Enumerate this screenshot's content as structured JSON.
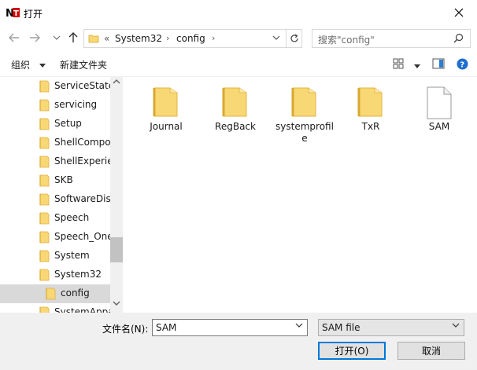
{
  "window": {
    "title": "打开"
  },
  "address": {
    "overflow": "«",
    "crumbs": [
      "System32",
      "config"
    ]
  },
  "search": {
    "placeholder": "搜索\"config\""
  },
  "toolbar": {
    "organize_label": "组织",
    "new_folder_label": "新建文件夹"
  },
  "sidebar": {
    "items": [
      {
        "label": "ServiceState"
      },
      {
        "label": "servicing"
      },
      {
        "label": "Setup"
      },
      {
        "label": "ShellCompo"
      },
      {
        "label": "ShellExperie"
      },
      {
        "label": "SKB"
      },
      {
        "label": "SoftwareDist"
      },
      {
        "label": "Speech"
      },
      {
        "label": "Speech_One"
      },
      {
        "label": "System"
      },
      {
        "label": "System32"
      },
      {
        "label": "config"
      },
      {
        "label": "SystemAppa"
      }
    ],
    "selected_index": 11
  },
  "files": [
    {
      "name": "Journal",
      "type": "folder"
    },
    {
      "name": "RegBack",
      "type": "folder"
    },
    {
      "name": "systemprofile",
      "type": "folder"
    },
    {
      "name": "TxR",
      "type": "folder"
    },
    {
      "name": "SAM",
      "type": "file"
    }
  ],
  "bottom": {
    "filename_label": "文件名(N):",
    "filename_value": "SAM",
    "filetype_value": "SAM file",
    "open_label": "打开(O)",
    "cancel_label": "取消"
  },
  "colors": {
    "accent": "#0078d7",
    "folder": "#f8d775",
    "selection": "#d9d9d9"
  }
}
